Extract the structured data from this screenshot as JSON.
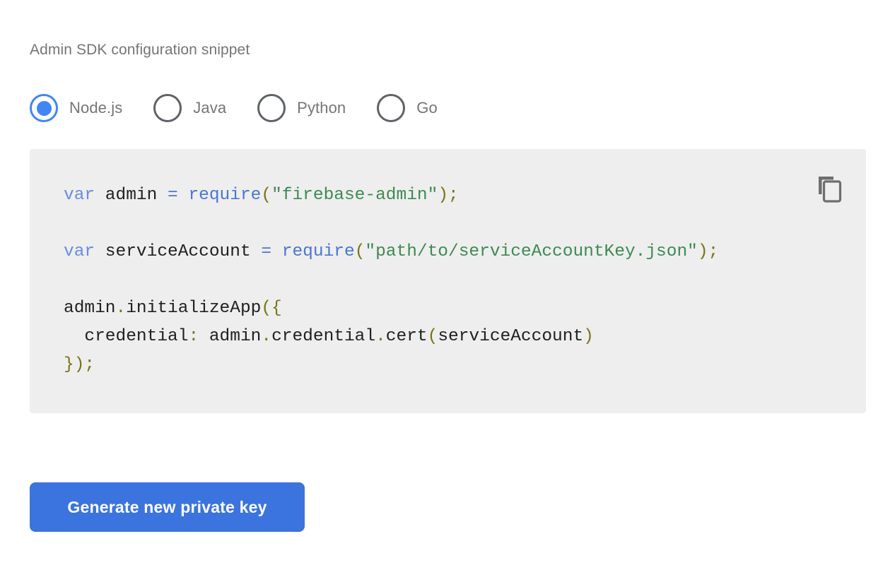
{
  "section": {
    "title": "Admin SDK configuration snippet"
  },
  "language_selector": {
    "selected": "Node.js",
    "options": [
      {
        "label": "Node.js",
        "selected": true
      },
      {
        "label": "Java",
        "selected": false
      },
      {
        "label": "Python",
        "selected": false
      },
      {
        "label": "Go",
        "selected": false
      }
    ]
  },
  "code_snippet": {
    "language": "Node.js",
    "copy_icon": "copy-icon",
    "lines": [
      [
        {
          "t": "var",
          "c": "kw"
        },
        {
          "t": " admin ",
          "c": "plain"
        },
        {
          "t": "=",
          "c": "fn"
        },
        {
          "t": " ",
          "c": "plain"
        },
        {
          "t": "require",
          "c": "fn"
        },
        {
          "t": "(",
          "c": "punct"
        },
        {
          "t": "\"firebase-admin\"",
          "c": "str"
        },
        {
          "t": ")",
          "c": "punct"
        },
        {
          "t": ";",
          "c": "punct"
        }
      ],
      [],
      [
        {
          "t": "var",
          "c": "kw"
        },
        {
          "t": " serviceAccount ",
          "c": "plain"
        },
        {
          "t": "=",
          "c": "fn"
        },
        {
          "t": " ",
          "c": "plain"
        },
        {
          "t": "require",
          "c": "fn"
        },
        {
          "t": "(",
          "c": "punct"
        },
        {
          "t": "\"path/to/serviceAccountKey.json\"",
          "c": "str"
        },
        {
          "t": ")",
          "c": "punct"
        },
        {
          "t": ";",
          "c": "punct"
        }
      ],
      [],
      [
        {
          "t": "admin",
          "c": "plain"
        },
        {
          "t": ".",
          "c": "punct"
        },
        {
          "t": "initializeApp",
          "c": "plain"
        },
        {
          "t": "({",
          "c": "punct"
        }
      ],
      [
        {
          "t": "  credential",
          "c": "plain"
        },
        {
          "t": ":",
          "c": "punct"
        },
        {
          "t": " admin",
          "c": "plain"
        },
        {
          "t": ".",
          "c": "punct"
        },
        {
          "t": "credential",
          "c": "plain"
        },
        {
          "t": ".",
          "c": "punct"
        },
        {
          "t": "cert",
          "c": "plain"
        },
        {
          "t": "(",
          "c": "punct"
        },
        {
          "t": "serviceAccount",
          "c": "plain"
        },
        {
          "t": ")",
          "c": "punct"
        }
      ],
      [
        {
          "t": "});",
          "c": "punct"
        }
      ]
    ],
    "plain_text": "var admin = require(\"firebase-admin\");\n\nvar serviceAccount = require(\"path/to/serviceAccountKey.json\");\n\nadmin.initializeApp({\n  credential: admin.credential.cert(serviceAccount)\n});"
  },
  "actions": {
    "generate_key_label": "Generate new private key"
  },
  "colors": {
    "accent_blue": "#4285f4",
    "button_blue": "#3b74de",
    "code_background": "#eeeeee",
    "text_grey": "#757575",
    "radio_unselected": "#5f6368",
    "syntax_keyword": "#6a8de0",
    "syntax_function": "#4a76d4",
    "syntax_string": "#3d8b52",
    "syntax_punctuation": "#7a7413"
  }
}
